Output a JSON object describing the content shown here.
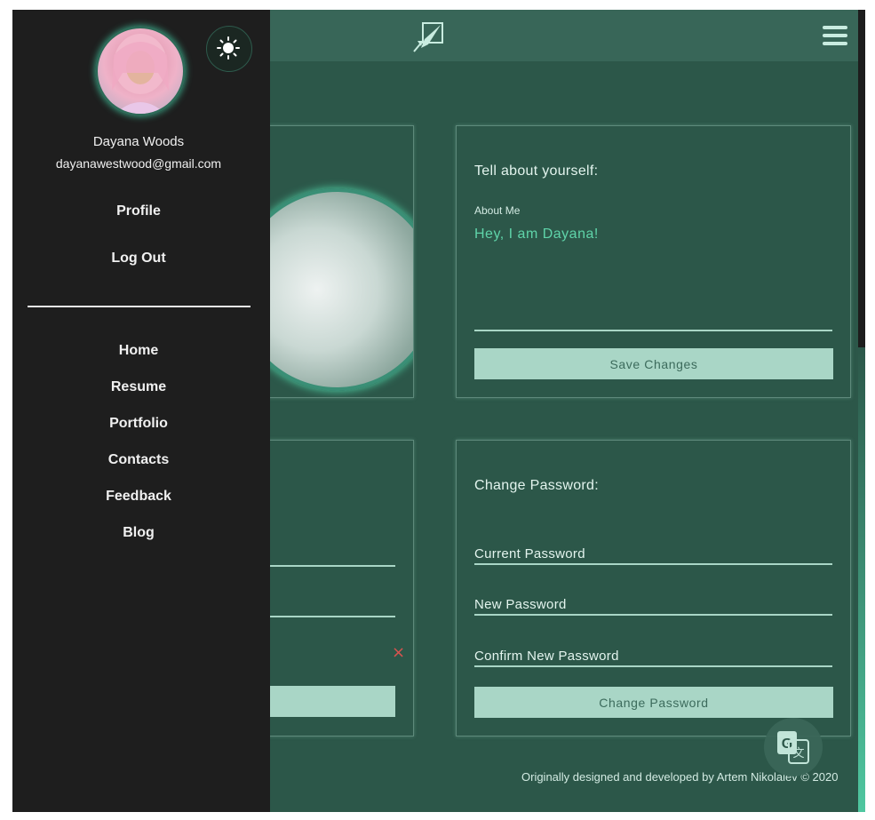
{
  "sidebar": {
    "name": "Dayana Woods",
    "email": "dayanawestwood@gmail.com",
    "account_items": [
      {
        "label": "Profile"
      },
      {
        "label": "Log Out"
      }
    ],
    "nav_items": [
      {
        "label": "Home"
      },
      {
        "label": "Resume"
      },
      {
        "label": "Portfolio"
      },
      {
        "label": "Contacts"
      },
      {
        "label": "Feedback"
      },
      {
        "label": "Blog"
      }
    ]
  },
  "about": {
    "heading": "Tell about yourself:",
    "label": "About Me",
    "value": "Hey, I am Dayana!",
    "save_button": "Save Changes"
  },
  "password": {
    "heading": "Change Password:",
    "fields": [
      {
        "label": "Current Password"
      },
      {
        "label": "New Password"
      },
      {
        "label": "Confirm New Password"
      }
    ],
    "button": "Change Password"
  },
  "info_card": {
    "remove_symbol": "×"
  },
  "footer": {
    "text": "Originally designed and developed by Artem Nikolaiev © 2020"
  },
  "icons": {
    "logo": "rocket-icon",
    "menu": "hamburger-icon",
    "theme": "sun-icon",
    "translate": "translate-icon"
  },
  "colors": {
    "background": "#2c5749",
    "topbar": "#386658",
    "drawer": "#1e1e1e",
    "accent": "#5fd4a9",
    "button": "#a9d6c6",
    "error": "#d9534f"
  }
}
